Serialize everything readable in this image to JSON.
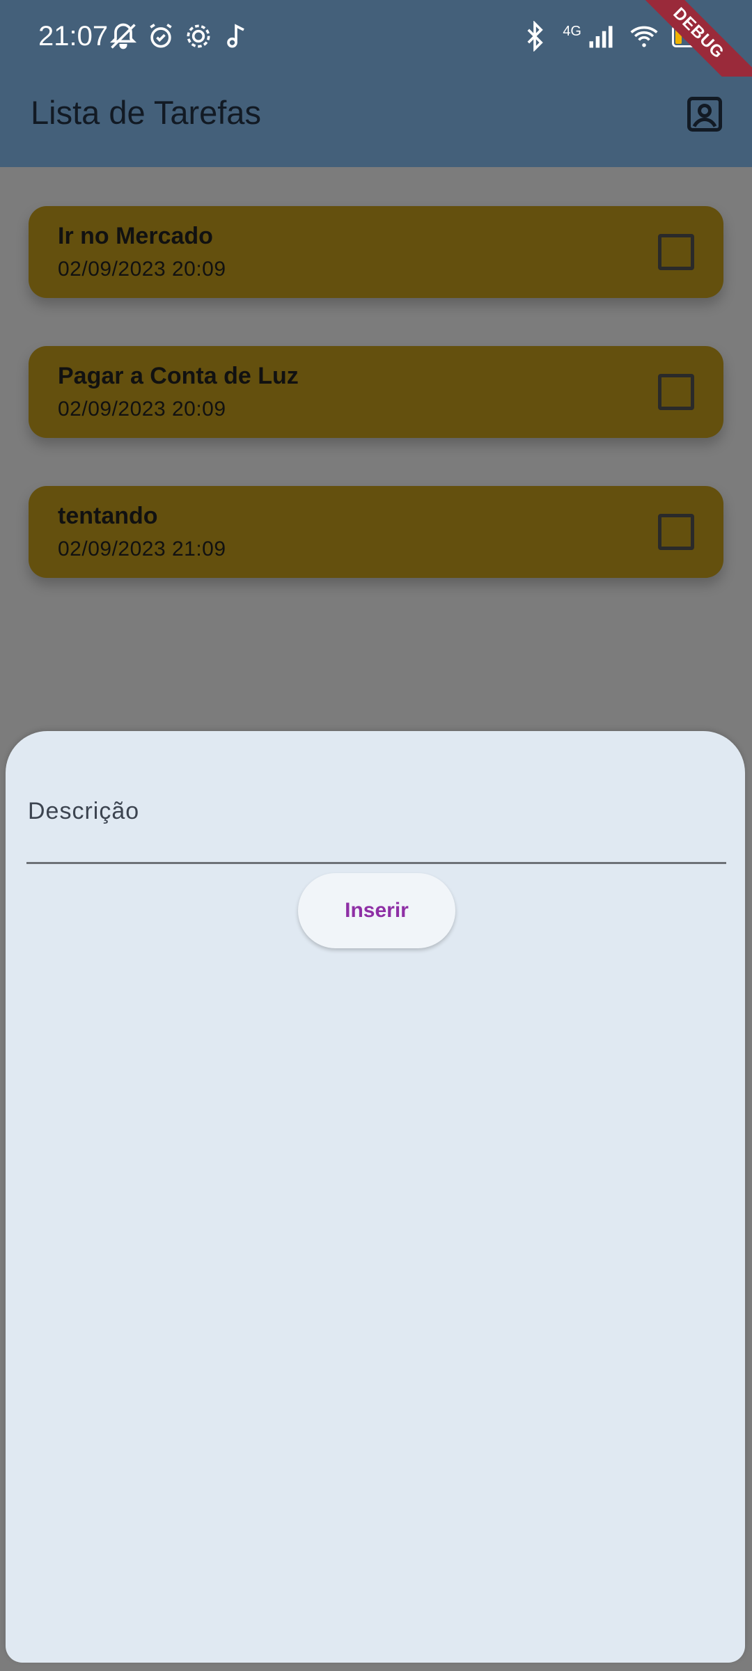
{
  "status_bar": {
    "time": "21:07",
    "battery": "17",
    "network": "4G",
    "left_icons": [
      "bell-off-icon",
      "alarm-icon",
      "settings-icon",
      "music-note-icon"
    ],
    "right_icons": [
      "bluetooth-icon",
      "signal-icon",
      "wifi-icon",
      "battery-icon"
    ]
  },
  "app_bar": {
    "title": "Lista de Tarefas",
    "profile_icon": "contact-icon",
    "background": "#44607a"
  },
  "debug_label": "DEBUG",
  "tasks": [
    {
      "title": "Ir no Mercado",
      "date": "02/09/2023 20:09",
      "checked": false
    },
    {
      "title": "Pagar a Conta de Luz",
      "date": "02/09/2023 20:09",
      "checked": false
    },
    {
      "title": "tentando",
      "date": "02/09/2023 21:09",
      "checked": false
    }
  ],
  "sheet": {
    "input_label": "Descrição",
    "input_value": "",
    "insert_label": "Inserir",
    "accent_color": "#8e2fa5"
  }
}
